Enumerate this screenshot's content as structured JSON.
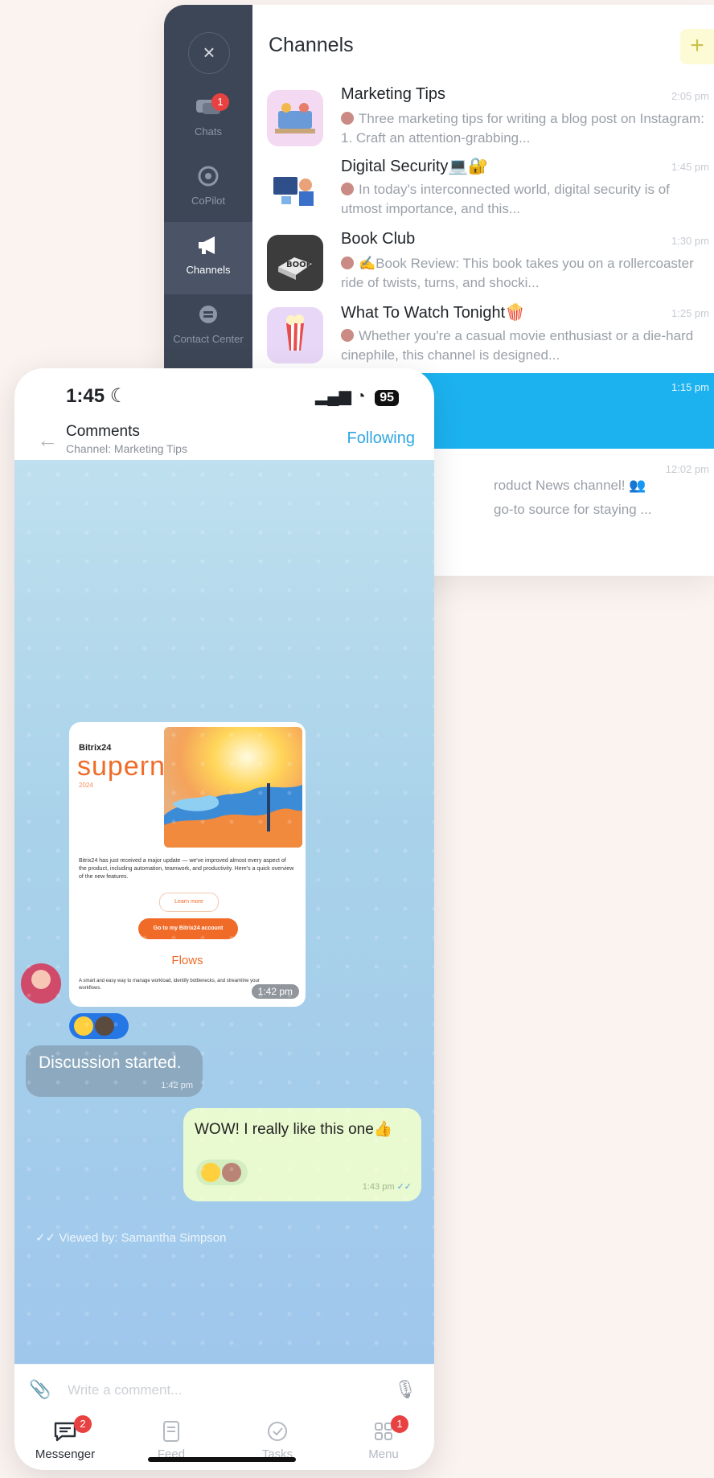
{
  "channels_panel": {
    "title": "Channels",
    "add_label": "+",
    "close_label": "×",
    "rail": [
      {
        "label": "Chats",
        "badge": "1"
      },
      {
        "label": "CoPilot"
      },
      {
        "label": "Channels"
      },
      {
        "label": "Contact Center"
      }
    ],
    "items": [
      {
        "name": "Marketing Tips",
        "time": "2:05 pm",
        "preview": "Three marketing tips for writing a blog post on Instagram: 1. Craft an attention-grabbing..."
      },
      {
        "name": "Digital Security💻🔐",
        "time": "1:45 pm",
        "preview": "In today's interconnected world, digital security is of utmost importance, and this..."
      },
      {
        "name": "Book Club",
        "time": "1:30 pm",
        "preview": "✍️Book Review: This book takes you on a rollercoaster ride of twists, turns, and shocki..."
      },
      {
        "name": "What To Watch Tonight🍿",
        "time": "1:25 pm",
        "preview": "Whether you're a casual movie enthusiast or a die-hard cinephile, this channel is designed..."
      }
    ],
    "selected_time": "1:15 pm",
    "product_news": {
      "time": "12:02 pm",
      "line1": "roduct News channel! 👥",
      "line2": "go-to source for staying ..."
    }
  },
  "phone": {
    "status_time": "1:45",
    "battery": "95",
    "header": {
      "title": "Comments",
      "subtitle": "Channel: Marketing Tips",
      "following": "Following"
    },
    "post": {
      "brand": "Bitrix24",
      "wordmark": "supernova",
      "year": "2024",
      "body": "Bitrix24 has just received a major update — we've improved almost every aspect of the product, including automation, teamwork, and productivity. Here's a quick overview of the new features.",
      "learn_more": "Learn more",
      "go_button": "Go to my Bitrix24 account",
      "flows_title": "Flows",
      "flows_body": "A smart and easy way to manage workload, identify bottlenecks, and streamline your workflows.",
      "time": "1:42 pm"
    },
    "system_message": {
      "text": "Discussion started.",
      "time": "1:42 pm"
    },
    "outgoing": {
      "text": "WOW! I really like this one👍",
      "time": "1:43 pm"
    },
    "viewed_by": "Viewed by: Samantha Simpson",
    "composer": {
      "placeholder": "Write a comment..."
    },
    "tabs": [
      {
        "label": "Messenger",
        "badge": "2"
      },
      {
        "label": "Feed"
      },
      {
        "label": "Tasks"
      },
      {
        "label": "Menu",
        "badge": "1"
      }
    ]
  }
}
